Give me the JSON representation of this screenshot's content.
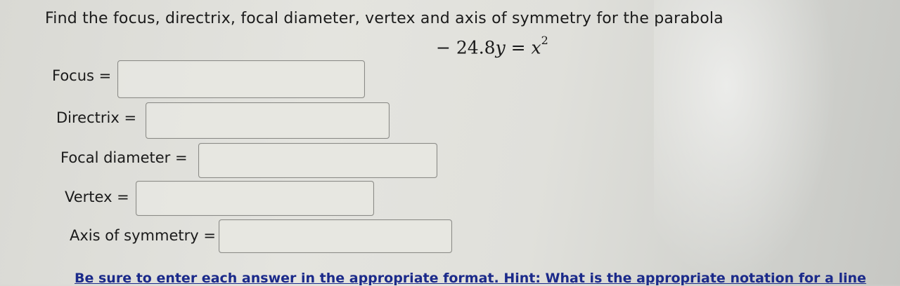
{
  "question": {
    "prompt": "Find the focus, directrix, focal diameter, vertex and axis of symmetry for the parabola",
    "equation": {
      "lhs_coefficient": "− 24.8",
      "lhs_variable": "y",
      "equals": "=",
      "rhs_variable": "x",
      "rhs_exponent": "2"
    }
  },
  "fields": [
    {
      "label": "Focus =",
      "value": ""
    },
    {
      "label": "Directrix =",
      "value": ""
    },
    {
      "label": "Focal diameter =",
      "value": ""
    },
    {
      "label": "Vertex =",
      "value": ""
    },
    {
      "label": "Axis of symmetry =",
      "value": ""
    }
  ],
  "hint": "Be sure to enter each answer in the appropriate format. Hint: What is the appropriate notation for a line"
}
